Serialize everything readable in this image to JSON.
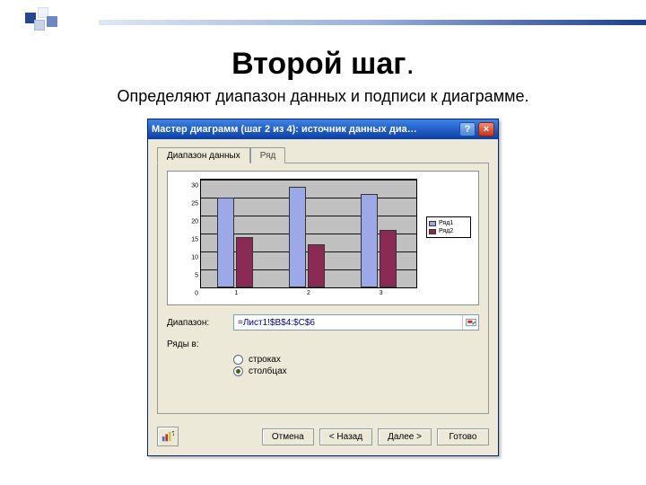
{
  "slide": {
    "title": "Второй шаг",
    "title_dot": ".",
    "subtitle": "Определяют диапазон данных и подписи к диаграмме."
  },
  "dialog": {
    "title": "Мастер диаграмм (шаг 2 из 4): источник данных диа…",
    "help_btn": "?",
    "close_btn": "×",
    "tab_range": "Диапазон данных",
    "tab_series": "Ряд",
    "range_label": "Диапазон:",
    "range_value": "=Лист1!$B$4:$C$6",
    "rows_label": "Ряды в:",
    "radio_rows": "строках",
    "radio_cols": "столбцах",
    "btn_help_icon": "help-chart-icon",
    "btn_cancel": "Отмена",
    "btn_back": "< Назад",
    "btn_next": "Далее >",
    "btn_finish": "Готово"
  },
  "chart_data": {
    "type": "bar",
    "categories": [
      "1",
      "2",
      "3"
    ],
    "series": [
      {
        "name": "Ряд1",
        "values": [
          25,
          28,
          26
        ],
        "color": "#9da8e6"
      },
      {
        "name": "Ряд2",
        "values": [
          14,
          12,
          16
        ],
        "color": "#8a2a55"
      }
    ],
    "ylim": [
      0,
      30
    ],
    "yticks": [
      0,
      5,
      10,
      15,
      20,
      25,
      30
    ],
    "xlabel": "",
    "ylabel": "",
    "title": ""
  }
}
